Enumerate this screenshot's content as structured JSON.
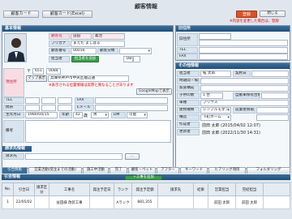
{
  "toolbar": {
    "card_label": "顧客カード",
    "card_excel_label": "顧客カード(Excel)"
  },
  "page_title": "顧客情報",
  "actions": {
    "register_label": "登録",
    "close_label": "閉じる"
  },
  "required_note": "※内容を変更した場合は、登録",
  "basic": {
    "header": "基本情報",
    "name_label": "顧客名",
    "name_family": "田田",
    "name_given": "義治",
    "kana_label": "フリガナ",
    "kana_value": "まえだ よしはる",
    "code_label": "顧客番号",
    "code_value": "00016",
    "category_label": "顧客分類",
    "staff_label": "担当者",
    "staff_button": "担当者を追加",
    "ob_label": "OB",
    "address_label": "現住所",
    "postal_value": "651",
    "postal_code_value": "0084",
    "map_button": "マップ表示",
    "address_value": "兵庫県神戸市中央区磯辺通",
    "address_warning": "※表示される位置情報は実際と異なることがあります",
    "googlemap_button": "GoogleMapで表示",
    "tel_label": "TEL",
    "fax_label": "FAX",
    "mobile_label": "携帯",
    "email_label": "Eメール",
    "birth_label": "生年月日",
    "birth_value": "1980/04/15",
    "age_label": "年齢",
    "age_value": "42",
    "age_unit": "歳",
    "gender_value": "男",
    "dm_label": "DM",
    "dm_value": "可能",
    "notes_label": "備考"
  },
  "old_address": {
    "header": "旧住所",
    "postal_label": "旧住所",
    "tel_label": "TEL",
    "fax_label": "FAX"
  },
  "other": {
    "header": "その他情報",
    "rep_label": "担当者",
    "rep_value": "桜 太郎",
    "contract_date_label": "契約日",
    "timing_label": "時期間・場日",
    "family_label": "家族構成",
    "children_label": "子供の数",
    "children_value": "1 台",
    "kids_label": "自動車保有台数",
    "car_label": "車種",
    "car_value": "プリウス",
    "building_label": "建物種類",
    "building_value": "シンプルモダン",
    "prev_label": "前業者情報",
    "building_type_label": "構造",
    "building_type_value": "下町ホーム",
    "creator_label": "作成者",
    "creator_value": "前田 太郎 (2015/04/02 12:07)",
    "updater_label": "更新者",
    "updater_value": "前田 太郎 (2022/11/30 14:31)"
  },
  "billing": {
    "header": "請求先情報",
    "billing_label": "請求先"
  },
  "tabs": [
    "引合情報",
    "営業活動(受注までの活動)",
    "施工中活動",
    "完了",
    "顧客・ペット",
    "アフター",
    "キーワード",
    "ヒアリング項目",
    "フォルダリング"
  ],
  "inquiry": {
    "header": "引合情報",
    "add_button": "+工事を追加",
    "columns": [
      "No.",
      "引合日",
      "請求区分",
      "工事名",
      "発注予定日",
      "ランク",
      "発注予定額",
      "請求先",
      "結果",
      "営業担当",
      "完結担当",
      ""
    ],
    "rows": [
      [
        "1",
        "22/05/02",
        "",
        "益田様 改装工事",
        "",
        "Aランク",
        "881,355",
        "",
        "",
        "前田 太郎",
        "前田 太郎",
        ""
      ]
    ]
  }
}
